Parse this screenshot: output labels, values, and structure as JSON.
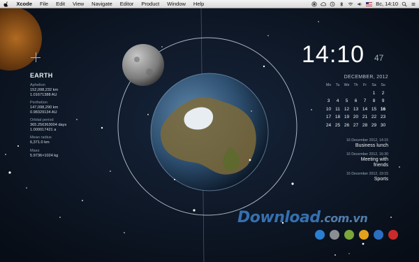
{
  "menubar": {
    "items": [
      "Xcode",
      "File",
      "Edit",
      "View",
      "Navigate",
      "Editor",
      "Product",
      "Window",
      "Help"
    ],
    "status_time": "Вс, 14:10"
  },
  "planet": {
    "name": "EARTH",
    "properties": [
      {
        "label": "Aphelion",
        "values": [
          "152,098,232 km",
          "1.01671388 AU"
        ]
      },
      {
        "label": "Perihelion",
        "values": [
          "147,098,290 km",
          "0.98329134 AU"
        ]
      },
      {
        "label": "Orbital period",
        "values": [
          "365.256363004 days",
          "1.000017421 a"
        ]
      },
      {
        "label": "Mean radius",
        "values": [
          "6,371.0 km"
        ]
      },
      {
        "label": "Mass",
        "values": [
          "5.9736×1024 kg"
        ]
      }
    ]
  },
  "clock": {
    "hours_minutes": "14:10",
    "seconds": "47"
  },
  "calendar": {
    "title": "DECEMBER, 2012",
    "weekdays": [
      "Mo",
      "Tu",
      "We",
      "Th",
      "Fr",
      "Sa",
      "Su"
    ],
    "weeks": [
      [
        "",
        "",
        "",
        "",
        "",
        "1",
        "2"
      ],
      [
        "3",
        "4",
        "5",
        "6",
        "7",
        "8",
        "9"
      ],
      [
        "10",
        "11",
        "12",
        "13",
        "14",
        "15",
        "16"
      ],
      [
        "17",
        "18",
        "19",
        "20",
        "21",
        "22",
        "23"
      ],
      [
        "24",
        "25",
        "26",
        "27",
        "28",
        "29",
        "30"
      ]
    ],
    "today": "16"
  },
  "events": [
    {
      "date": "16 December 2012, 14:15",
      "title": "Business lunch"
    },
    {
      "date": "16 December 2012, 16:30",
      "title": "Meeting with friends"
    },
    {
      "date": "16 December 2012, 19:15",
      "title": "Sports"
    }
  ],
  "watermark": {
    "main": "Download",
    "suffix": ".com.vn"
  },
  "theme_colors": [
    "#2a7fd0",
    "#8a8d92",
    "#7aa63a",
    "#e3a21a",
    "#2a6fc0",
    "#c92a2a"
  ]
}
